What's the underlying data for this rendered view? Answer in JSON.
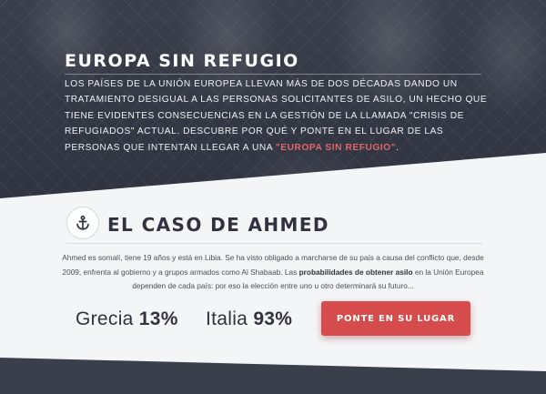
{
  "hero": {
    "title": "EUROPA SIN REFUGIO",
    "paragraph_text": "Los países de la Unión Europea llevan más de dos décadas dando un tratamiento desigual a las personas solicitantes de asilo, un hecho que tiene evidentes consecuencias en la gestión de la llamada \"crisis de refugiados\" actual. Descubre por qué y ponte en el lugar de las personas que intentan llegar a una ",
    "highlight": "\"Europa sin refugio\"",
    "tail": "."
  },
  "case": {
    "icon": "anchor-icon",
    "title": "EL CASO DE AHMED",
    "text_before": "Ahmed es somalí, tiene 19 años y está en Libia. Se ha visto obligado a marcharse de su país a causa del conflicto que, desde 2009, enfrenta al gobierno y a grupos armados como Al Shabaab. Las ",
    "text_bold": "probabilidades de obtener asilo",
    "text_after": " en la Unión Europea dependen de cada país: por eso la elección entre uno u otro determinará su futuro..."
  },
  "stats": [
    {
      "country": "Grecia",
      "value": "13%"
    },
    {
      "country": "Italia",
      "value": "93%"
    }
  ],
  "cta": {
    "label": "PONTE EN SU LUGAR"
  },
  "colors": {
    "accent": "#d64b4b",
    "highlight": "#e0676a",
    "dark": "#2f3340",
    "light_bg": "#f4f5f6"
  }
}
